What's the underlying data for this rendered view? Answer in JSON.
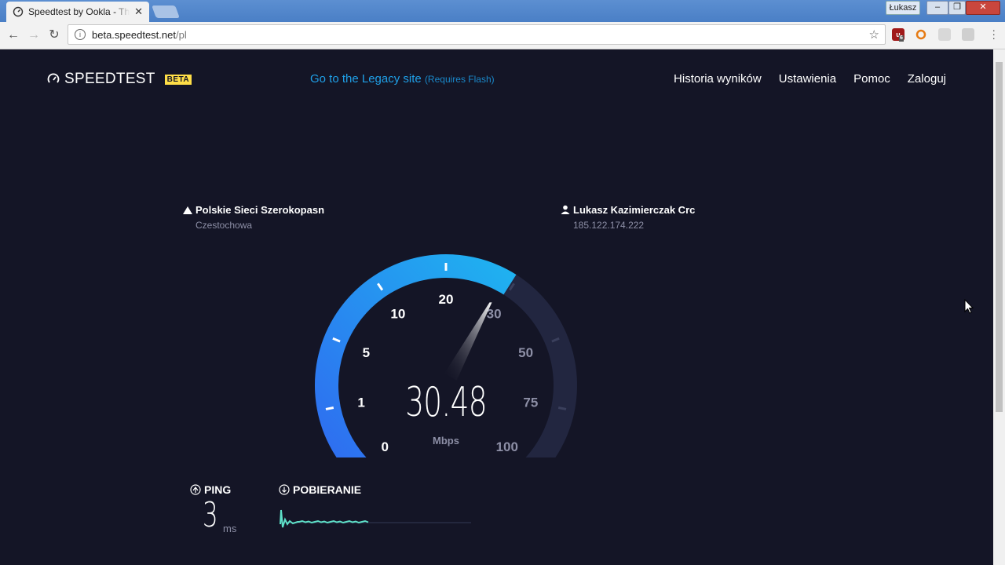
{
  "browser": {
    "tab_title": "Speedtest by Ookla - The Global Broadband Speed Test",
    "profile_name": "Łukasz",
    "url_host": "beta.speedtest.net",
    "url_path": "/pl",
    "extensions": [
      "ublock-icon",
      "tampermonkey-icon",
      "extension-icon",
      "extension-icon-2"
    ],
    "extension_badge": "6"
  },
  "header": {
    "logo_text": "SPEEDTEST",
    "beta_badge": "BETA",
    "legacy_link": "Go to the Legacy site",
    "legacy_note": "(Requires Flash)",
    "nav": [
      "Historia wyników",
      "Ustawienia",
      "Pomoc",
      "Zaloguj"
    ]
  },
  "server": {
    "name": "Polskie Sieci Szerokopasn",
    "city": "Czestochowa"
  },
  "client": {
    "name": "Lukasz Kazimierczak Crc",
    "ip": "185.122.174.222"
  },
  "gauge": {
    "ticks": [
      "0",
      "1",
      "5",
      "10",
      "20",
      "30",
      "50",
      "75",
      "100"
    ],
    "speed": "30.48",
    "unit": "Mbps",
    "fill_fraction": 0.62,
    "accent_color": "#1fa0e8",
    "accent_start": "#2f6bf0"
  },
  "metrics": {
    "ping_label": "PING",
    "ping_value": "3",
    "ping_unit": "ms",
    "download_label": "POBIERANIE",
    "download_progress": 0.49,
    "spark_color": "#5ee0c8"
  }
}
